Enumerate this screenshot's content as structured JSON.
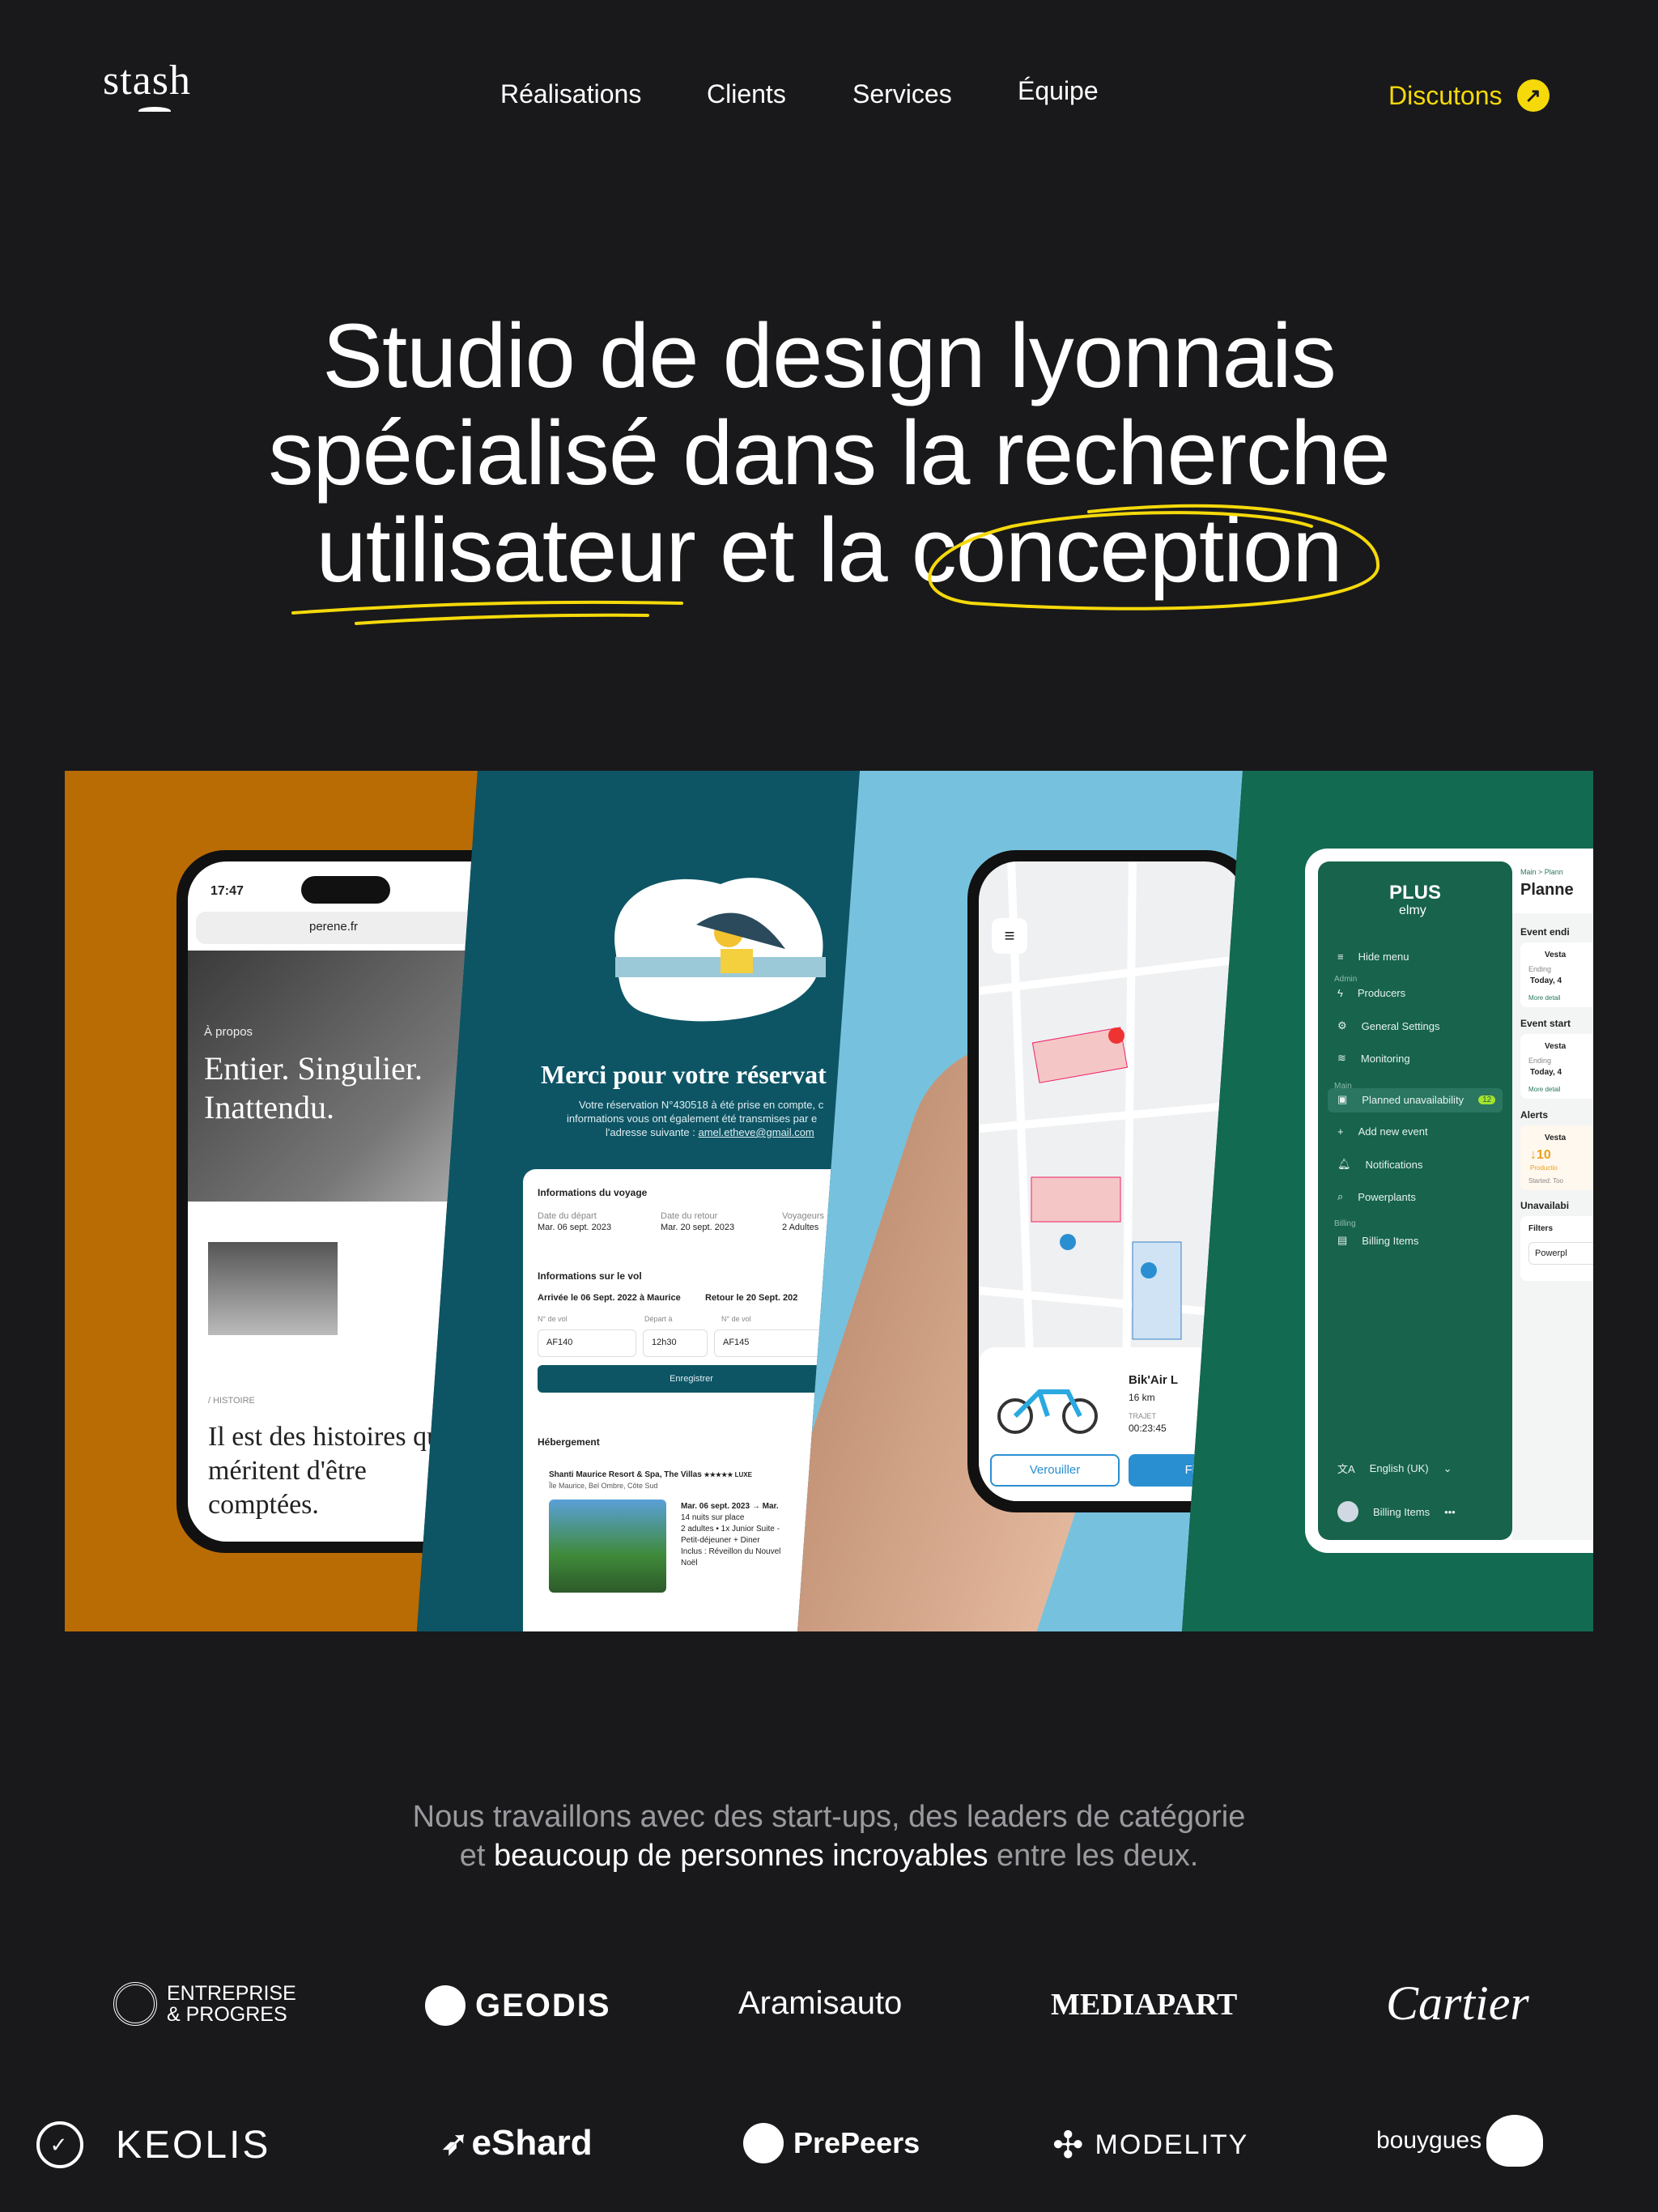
{
  "header": {
    "logo": "stash",
    "nav": [
      "Réalisations",
      "Clients",
      "Services",
      "Équipe"
    ],
    "cta": {
      "label": "Discutons",
      "icon": "arrow-up-right-icon"
    }
  },
  "hero": {
    "line1": "Studio de design lyonnais",
    "line2": "spécialisé dans la recherche",
    "line3_a": "utilisateur",
    "line3_b": " et la ",
    "line3_c": "conception",
    "accent": "#f5d90a"
  },
  "showcase": {
    "colors": {
      "orange": "#b96b04",
      "teal": "#0d5565",
      "blue": "#76c2de",
      "green": "#126a51"
    },
    "perene": {
      "time": "17:47",
      "url": "perene.fr",
      "section": "À propos",
      "headline": "Entier. Singulier. Inattendu.",
      "label": "/ HISTOIRE",
      "body": "Il est des histoires qui méritent d'être comptées."
    },
    "booking": {
      "title": "Merci pour votre réservat",
      "text1": "Votre réservation N°430518 à été prise en compte, c",
      "text2": "informations vous ont également été transmises par e",
      "text3": "l'adresse suivante : ",
      "email": "amel.etheve@gmail.com",
      "trip_title": "Informations du voyage",
      "dep_label": "Date du départ",
      "dep": "Mar. 06 sept. 2023",
      "ret_label": "Date du retour",
      "ret": "Mar. 20 sept. 2023",
      "trav_label": "Voyageurs",
      "trav": "2 Adultes",
      "flight_title": "Informations  sur le vol",
      "arr": "Arrivée le 06 Sept. 2022 à Maurice",
      "back": "Retour le 20 Sept. 202",
      "vol_label": "N° de vol",
      "depa_label": "Départ à",
      "vol1": "AF140",
      "time": "12h30",
      "vol2": "AF145",
      "save": "Enregistrer",
      "hotel_title": "Hébergement",
      "hotel": "Shanti Maurice Resort & Spa, The Villas",
      "stars": "★★★★★ LUXE",
      "place": "Île Maurice, Bel Ombre, Côte Sud",
      "details": [
        "Mar. 06 sept. 2023 → Mar.",
        "14 nuits sur place",
        "2 adultes  •  1x Junior Suite -",
        "Petit-déjeuner + Diner",
        "Inclus : Réveillon du Nouvel",
        "Noël"
      ]
    },
    "bike": {
      "name": "Bik'Air L",
      "range": "16 km",
      "trip_label": "TRAJET",
      "trip": "00:23:45",
      "lock": "Verouiller",
      "end": "Fin"
    },
    "elmy": {
      "brand": "PLUS",
      "sub": "elmy",
      "hide": "Hide menu",
      "admin": "Admin",
      "producers": "Producers",
      "settings": "General Settings",
      "monitoring": "Monitoring",
      "main": "Main",
      "planned": "Planned unavailability",
      "badge": "12",
      "add": "Add new event",
      "notif": "Notifications",
      "powerplants": "Powerplants",
      "billing": "Billing",
      "billing_items": "Billing Items",
      "lang": "English (UK)",
      "user": "Billing Items",
      "crumb": "Main  >  Plann",
      "page": "Planne",
      "ev_end": "Event endi",
      "ev_start": "Event start",
      "alerts": "Alerts",
      "unavail": "Unavailabi",
      "filters": "Filters",
      "filter_ph": "Powerpl",
      "vesta": "Vesta",
      "ending": "Ending",
      "today": "Today, 4",
      "more": "More detail",
      "pct": "↓10",
      "prod": "Productio",
      "started": "Started: Too"
    }
  },
  "clients": {
    "line1": "Nous travaillons avec des start-ups, des leaders de catégorie",
    "line2_a": "et ",
    "line2_b": "beaucoup de personnes incroyables",
    "line2_c": " entre les deux.",
    "logos_row1": [
      "ENTREPRISE",
      "& PROGRES",
      "GEODIS",
      "Aramisauto",
      "MEDIAPART",
      "Cartier"
    ],
    "logos_row2": [
      "KEOLIS",
      "eShard",
      "PrePeers",
      "MODELITY",
      "bouygues"
    ]
  }
}
